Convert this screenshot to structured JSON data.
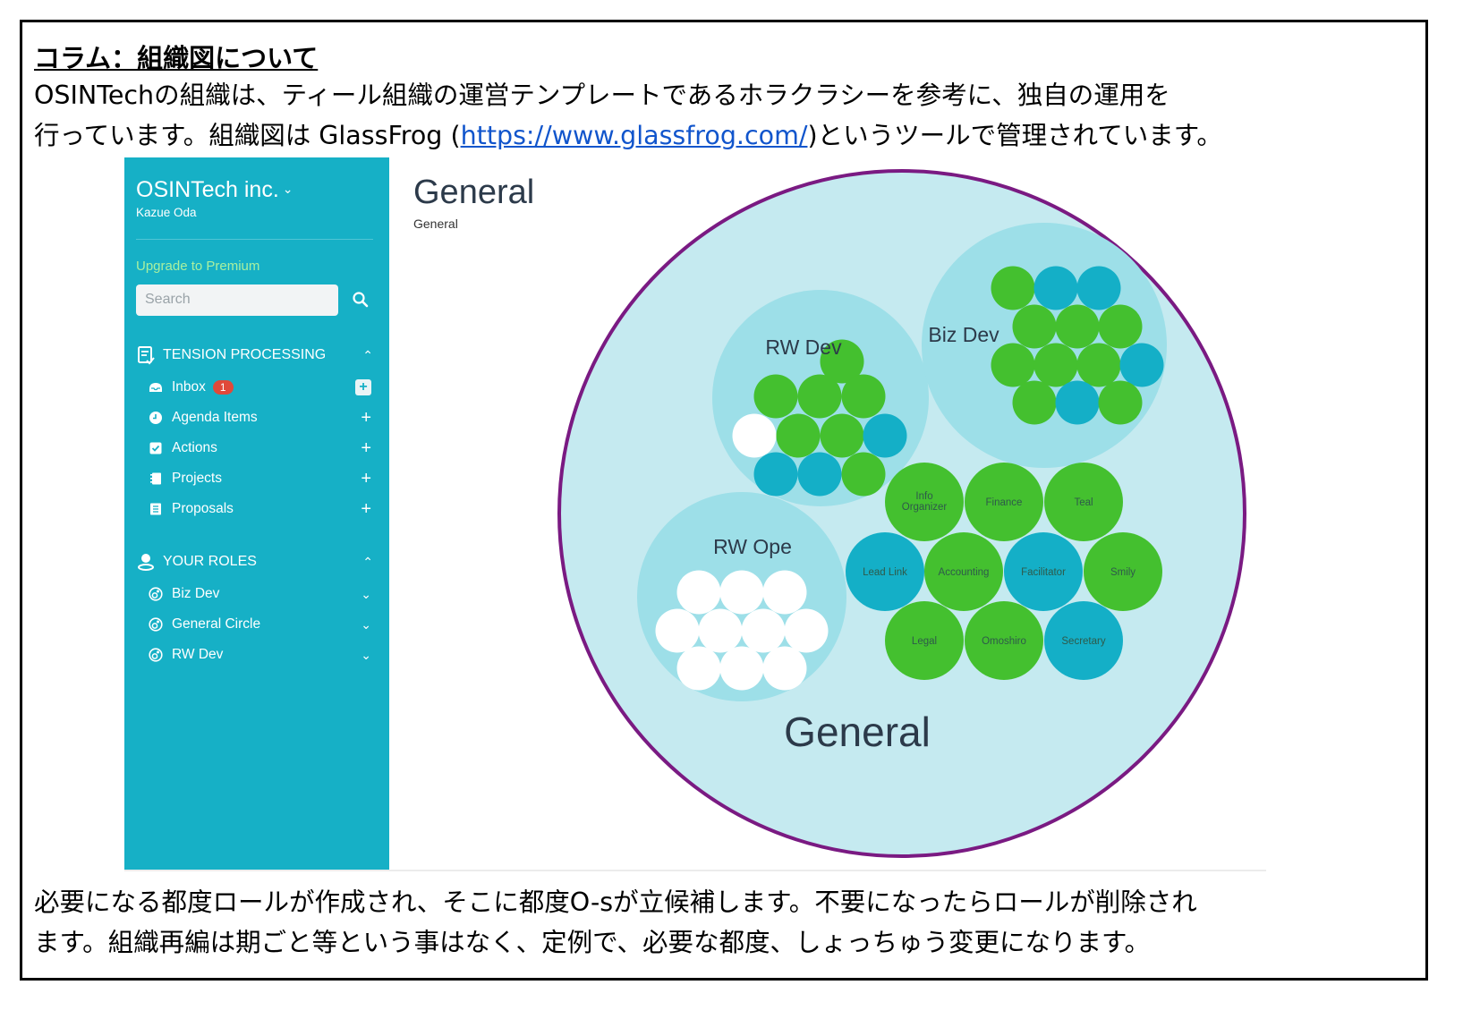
{
  "column": {
    "title": "コラム：組織図について",
    "intro_line1": "OSINTechの組織は、ティール組織の運営テンプレートであるホラクラシーを参考に、独自の運用を",
    "intro_line2_before": "行っています。組織図は GlassFrog (",
    "intro_link": "https://www.glassfrog.com/",
    "intro_line2_after": ")というツールで管理されています。",
    "outro_line1": "必要になる都度ロールが作成され、そこに都度O-sが立候補します。不要になったらロールが削除され",
    "outro_line2": "ます。組織再編は期ごと等という事はなく、定例で、必要な都度、しょっちゅう変更になります。"
  },
  "app": {
    "org_name": "OSINTech inc.",
    "user_name": "Kazue Oda",
    "upgrade_label": "Upgrade to Premium",
    "search_placeholder": "Search",
    "tension_section": {
      "label": "TENSION PROCESSING",
      "items": [
        {
          "label": "Inbox",
          "badge": "1",
          "icon": "inbox-icon",
          "action": "plus-box"
        },
        {
          "label": "Agenda Items",
          "icon": "clock-icon",
          "action": "plus"
        },
        {
          "label": "Actions",
          "icon": "checkbox-icon",
          "action": "plus"
        },
        {
          "label": "Projects",
          "icon": "notebook-icon",
          "action": "plus"
        },
        {
          "label": "Proposals",
          "icon": "document-icon",
          "action": "plus"
        }
      ]
    },
    "roles_section": {
      "label": "YOUR ROLES",
      "items": [
        {
          "label": "Biz Dev",
          "icon": "role-icon"
        },
        {
          "label": "General Circle",
          "icon": "role-icon"
        },
        {
          "label": "RW Dev",
          "icon": "role-icon"
        }
      ]
    },
    "main": {
      "title": "General",
      "breadcrumb": "General"
    },
    "colors": {
      "sidebar": "#16b0c6",
      "role_green": "#44c02f",
      "role_blue": "#14afc7",
      "role_white": "#ffffff",
      "circle_light": "#c5eaf0",
      "subcircle": "#9ddfe8",
      "general_border": "#7a1a82",
      "badge": "#e0493a",
      "upgrade_text": "#a8f0a0"
    },
    "org_chart": {
      "root": "General",
      "subcircles": [
        {
          "name": "RW Dev",
          "roles": [
            "green",
            "green",
            "green",
            "green",
            "white",
            "green",
            "green",
            "blue",
            "blue",
            "blue",
            "green"
          ]
        },
        {
          "name": "Biz Dev",
          "roles": [
            "green",
            "blue",
            "blue",
            "green",
            "green",
            "green",
            "green",
            "green",
            "green",
            "blue",
            "green",
            "blue",
            "green"
          ]
        },
        {
          "name": "RW Ope",
          "roles": [
            "white",
            "white",
            "white",
            "white",
            "white",
            "white",
            "white",
            "white",
            "white",
            "white"
          ]
        }
      ],
      "named_roles": [
        {
          "name": "Info Organizer",
          "color": "green"
        },
        {
          "name": "Finance",
          "color": "green"
        },
        {
          "name": "Teal",
          "color": "green"
        },
        {
          "name": "Lead Link",
          "color": "blue"
        },
        {
          "name": "Accounting",
          "color": "green"
        },
        {
          "name": "Facilitator",
          "color": "blue"
        },
        {
          "name": "Smily",
          "color": "green"
        },
        {
          "name": "Legal",
          "color": "green"
        },
        {
          "name": "Omoshiro",
          "color": "green"
        },
        {
          "name": "Secretary",
          "color": "blue"
        }
      ]
    }
  }
}
